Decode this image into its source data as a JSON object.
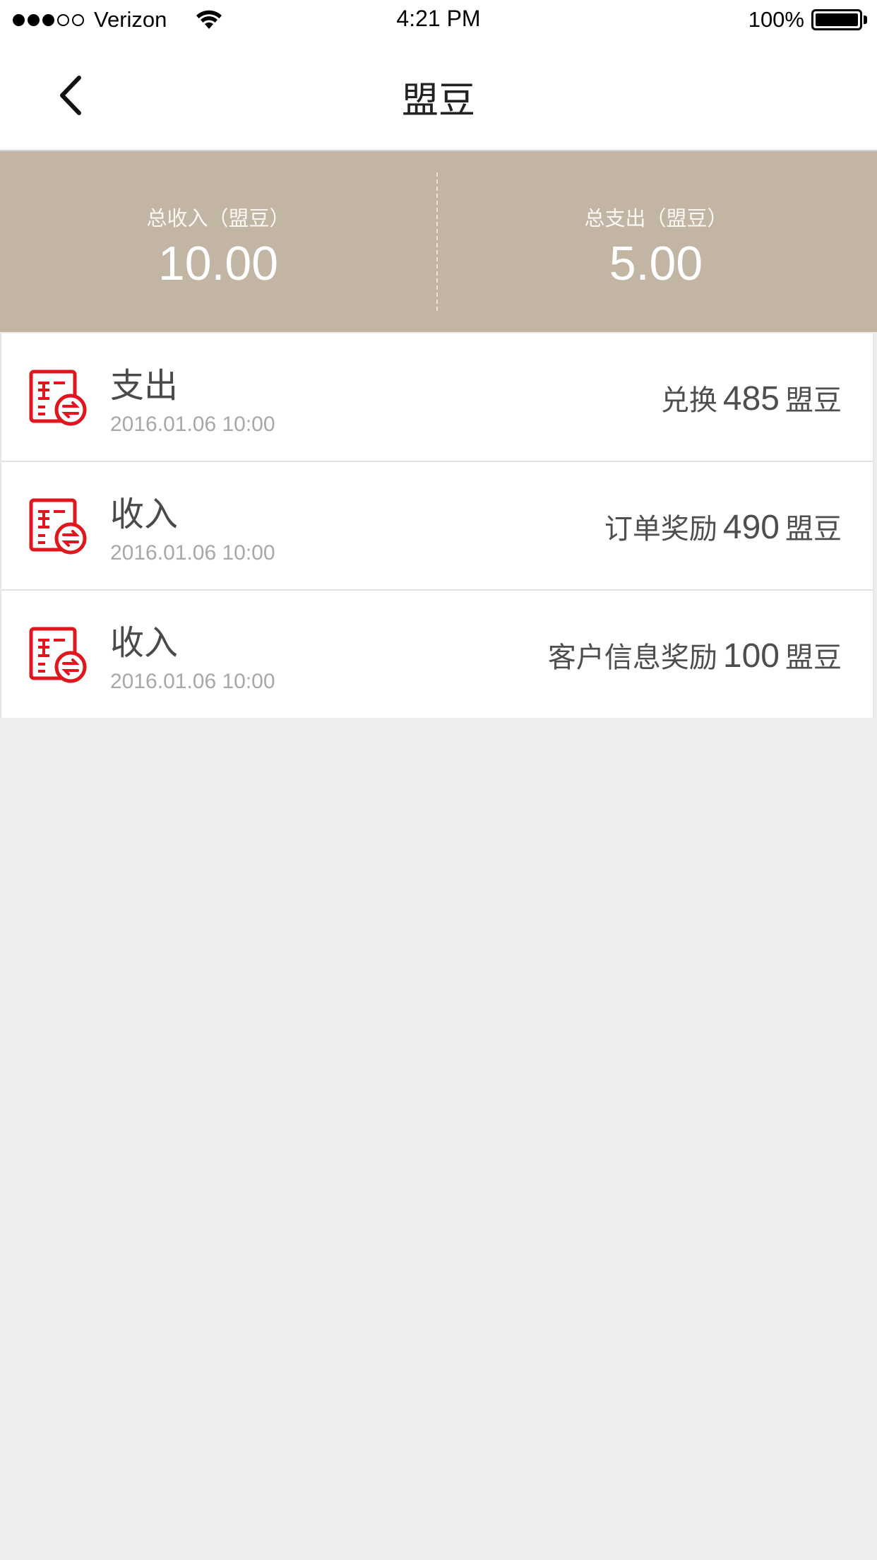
{
  "status_bar": {
    "carrier": "Verizon",
    "time": "4:21 PM",
    "battery": "100%",
    "signal_filled": 3,
    "signal_total": 5
  },
  "nav": {
    "title": "盟豆",
    "back_icon": "chevron-left-icon"
  },
  "summary": {
    "income_label": "总收入（盟豆）",
    "income_value": "10.00",
    "expense_label": "总支出（盟豆）",
    "expense_value": "5.00",
    "background_color": "#c2b5a4"
  },
  "transactions": [
    {
      "type": "支出",
      "date": "2016.01.06 10:00",
      "desc": "兑换",
      "amount": "485",
      "unit": "盟豆"
    },
    {
      "type": "收入",
      "date": "2016.01.06 10:00",
      "desc": "订单奖励",
      "amount": "490",
      "unit": "盟豆"
    },
    {
      "type": "收入",
      "date": "2016.01.06 10:00",
      "desc": "客户信息奖励",
      "amount": "100",
      "unit": "盟豆"
    }
  ],
  "icon_color": "#e0161f",
  "row_icon": "bill-exchange-icon"
}
